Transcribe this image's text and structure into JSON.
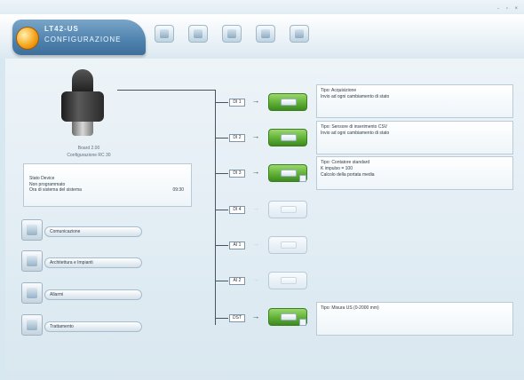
{
  "window": {
    "controls": "- ▫ ×"
  },
  "brand": {
    "title": "LT42-US",
    "subtitle": "CONFIGURAZIONE"
  },
  "toolbar": {
    "icons": [
      "open-icon",
      "save-icon",
      "sync-icon",
      "monitor-icon",
      "tools-icon"
    ]
  },
  "device": {
    "name": "Board 2.00",
    "configuration": "Configurazione RC 30",
    "status_lines": [
      "Stato Device",
      "Non programmato",
      "Ora di sistema del sistema"
    ],
    "status_value": "09:30"
  },
  "nav": [
    {
      "label": "Comunicazione",
      "icon": "communication-icon"
    },
    {
      "label": "Architettura e Impianti",
      "icon": "architecture-icon"
    },
    {
      "label": "Allarmi",
      "icon": "alarm-icon"
    },
    {
      "label": "Trattamento",
      "icon": "treatment-icon"
    }
  ],
  "channels": [
    {
      "label": "DI 1",
      "state": "active",
      "info": [
        "Tipo: Acquisizione",
        "Invio ad ogni cambiamento di stato"
      ]
    },
    {
      "label": "DI 2",
      "state": "active",
      "info": [
        "Tipo: Sensore di inserimento CSV",
        "Invio ad ogni cambiamento di stato"
      ]
    },
    {
      "label": "DI 3",
      "state": "active",
      "info": [
        "Tipo: Contatore standard",
        "K impulso = 100",
        "Calcolo della portata media"
      ]
    },
    {
      "label": "DI 4",
      "state": "inactive",
      "info": []
    },
    {
      "label": "AI 1",
      "state": "inactive",
      "info": []
    },
    {
      "label": "AI 2",
      "state": "inactive",
      "info": []
    },
    {
      "label": "DST",
      "state": "active",
      "info": [
        "Tipo: Misura US (0-2000 mm)"
      ]
    }
  ]
}
